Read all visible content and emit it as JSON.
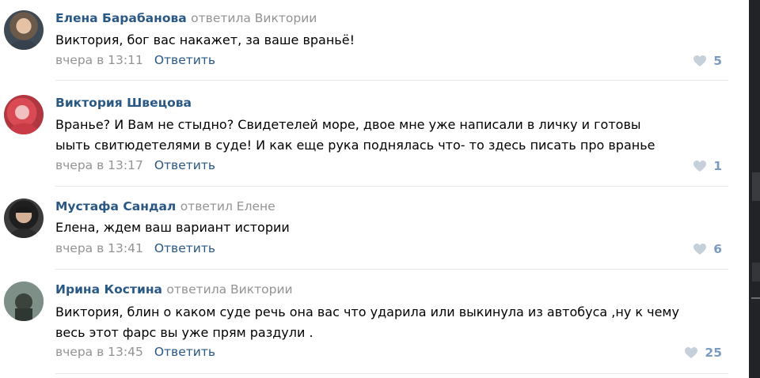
{
  "comments": [
    {
      "author": "Елена Барабанова",
      "reply_to": "ответила Виктории",
      "lines": [
        "Виктория, бог вас накажет, за ваше враньё!"
      ],
      "date": "вчера в 13:11",
      "reply_label": "Ответить",
      "likes": "5",
      "avatar_icon": "user-avatar-icon"
    },
    {
      "author": "Виктория Швецова",
      "reply_to": "",
      "lines": [
        "Вранье? И Вам не стыдно? Свидетелей море, двое мне уже написали в личку и готовы",
        "ыыть свитюдетелями в суде! И как еще рука поднялась что- то здесь писать про вранье"
      ],
      "date": "вчера в 13:17",
      "reply_label": "Ответить",
      "likes": "1",
      "avatar_icon": "user-avatar-icon"
    },
    {
      "author": "Мустафа Сандал",
      "reply_to": "ответил Елене",
      "lines": [
        "Елена, ждем ваш вариант истории"
      ],
      "date": "вчера в 13:41",
      "reply_label": "Ответить",
      "likes": "6",
      "avatar_icon": "user-avatar-icon"
    },
    {
      "author": "Ирина Костина",
      "reply_to": "ответила Виктории",
      "lines": [
        "Виктория, блин о каком суде речь она вас что ударила или выкинула из автобуса ,ну к чему",
        "весь этот фарс вы уже прям раздули ."
      ],
      "date": "вчера в 13:45",
      "reply_label": "Ответить",
      "likes": "25",
      "avatar_icon": "user-avatar-icon"
    }
  ],
  "colors": {
    "link": "#2a5885",
    "muted": "#939393",
    "like": "#7a9cc0",
    "divider": "#e7e8ec"
  },
  "icons": {
    "like": "heart-icon"
  }
}
